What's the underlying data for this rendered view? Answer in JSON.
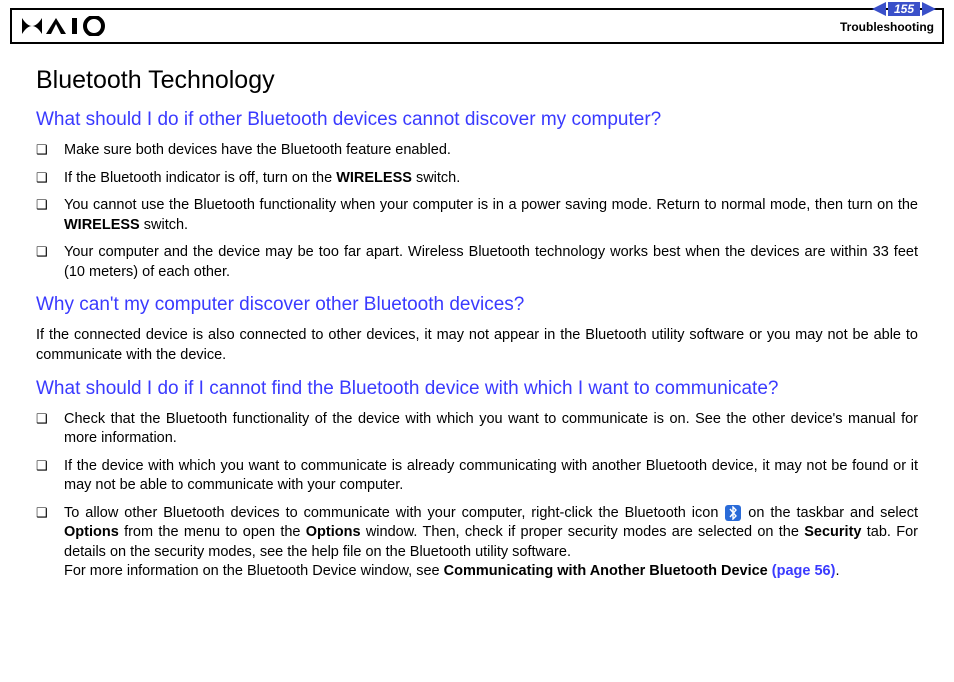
{
  "header": {
    "page_number": "155",
    "section": "Troubleshooting"
  },
  "main_title": "Bluetooth Technology",
  "q1": {
    "heading": "What should I do if other Bluetooth devices cannot discover my computer?",
    "b1": "Make sure both devices have the Bluetooth feature enabled.",
    "b2a": "If the Bluetooth indicator is off, turn on the ",
    "b2b": "WIRELESS",
    "b2c": " switch.",
    "b3a": "You cannot use the Bluetooth functionality when your computer is in a power saving mode. Return to normal mode, then turn on the ",
    "b3b": "WIRELESS",
    "b3c": " switch.",
    "b4": "Your computer and the device may be too far apart. Wireless Bluetooth technology works best when the devices are within 33 feet (10 meters) of each other."
  },
  "q2": {
    "heading": "Why can't my computer discover other Bluetooth devices?",
    "para": "If the connected device is also connected to other devices, it may not appear in the Bluetooth utility software or you may not be able to communicate with the device."
  },
  "q3": {
    "heading": "What should I do if I cannot find the Bluetooth device with which I want to communicate?",
    "b1": "Check that the Bluetooth functionality of the device with which you want to communicate is on. See the other device's manual for more information.",
    "b2": "If the device with which you want to communicate is already communicating with another Bluetooth device, it may not be found or it may not be able to communicate with your computer.",
    "b3a": "To allow other Bluetooth devices to communicate with your computer, right-click the Bluetooth icon ",
    "b3b": " on the taskbar and select ",
    "b3c": "Options",
    "b3d": " from the menu to open the ",
    "b3e": "Options",
    "b3f": " window. Then, check if proper security modes are selected on the ",
    "b3g": "Security",
    "b3h": " tab. For details on the security modes, see the help file on the Bluetooth utility software.",
    "b3i": "For more information on the Bluetooth Device window, see ",
    "b3j": "Communicating with Another Bluetooth Device ",
    "b3k": "(page 56)",
    "b3l": "."
  }
}
